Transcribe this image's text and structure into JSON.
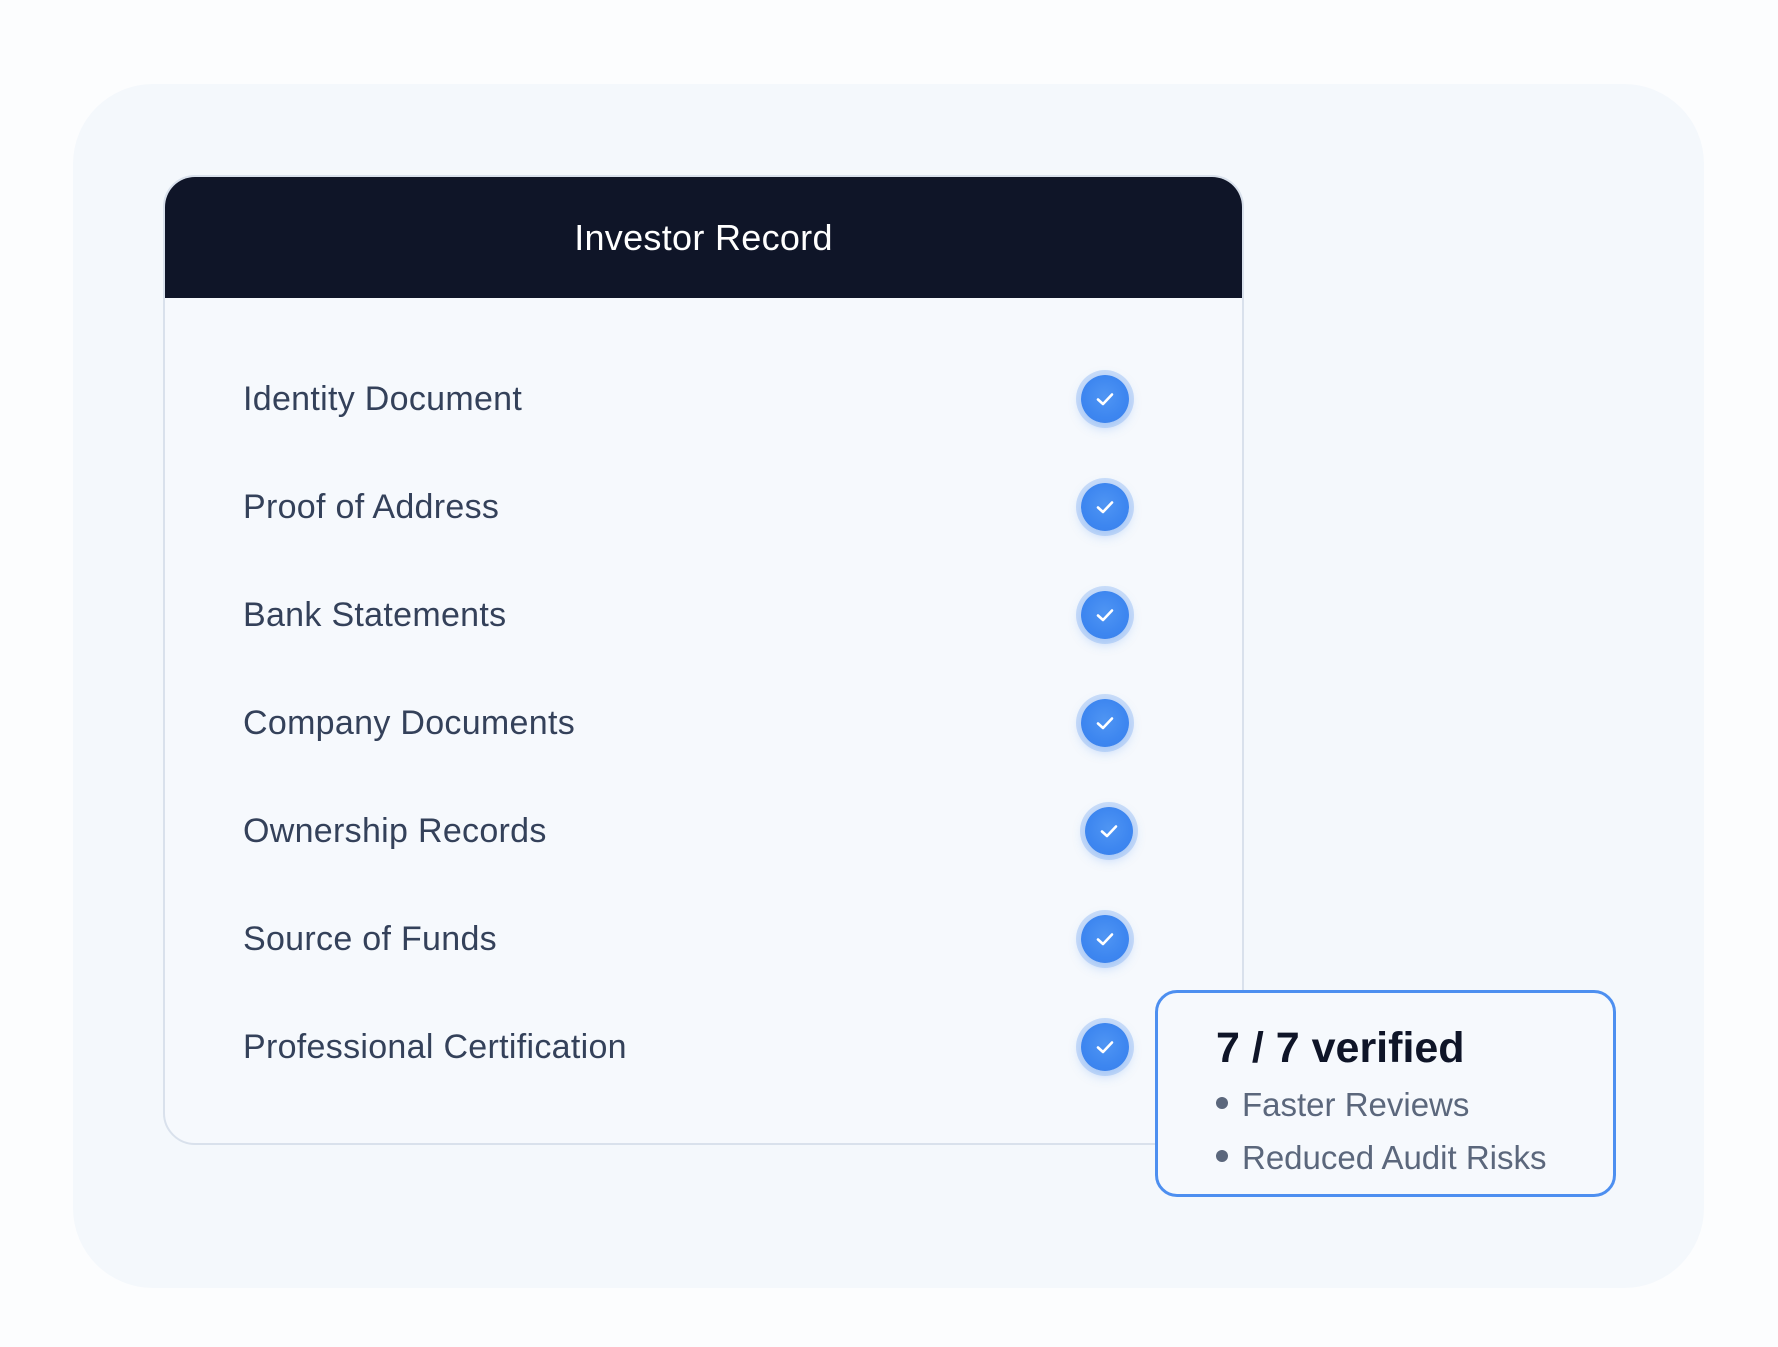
{
  "record_card": {
    "title": "Investor Record",
    "items": [
      {
        "label": "Identity Document",
        "verified": true
      },
      {
        "label": "Proof of Address",
        "verified": true
      },
      {
        "label": "Bank Statements",
        "verified": true
      },
      {
        "label": "Company Documents",
        "verified": true
      },
      {
        "label": "Ownership Records",
        "verified": true
      },
      {
        "label": "Source of Funds",
        "verified": true
      },
      {
        "label": "Professional Certification",
        "verified": true
      }
    ]
  },
  "summary": {
    "title": "7 / 7 verified",
    "verified_count": 7,
    "total_count": 7,
    "benefits": [
      "Faster Reviews",
      "Reduced Audit Risks"
    ]
  },
  "icons": {
    "verified": "check-circle-icon",
    "bullet": "bullet-dot-icon"
  },
  "colors": {
    "header_bg": "#0f1528",
    "accent": "#3d86f0",
    "text": "#34415a",
    "muted_text": "#5b677c",
    "panel_bg": "#f4f8fc"
  }
}
